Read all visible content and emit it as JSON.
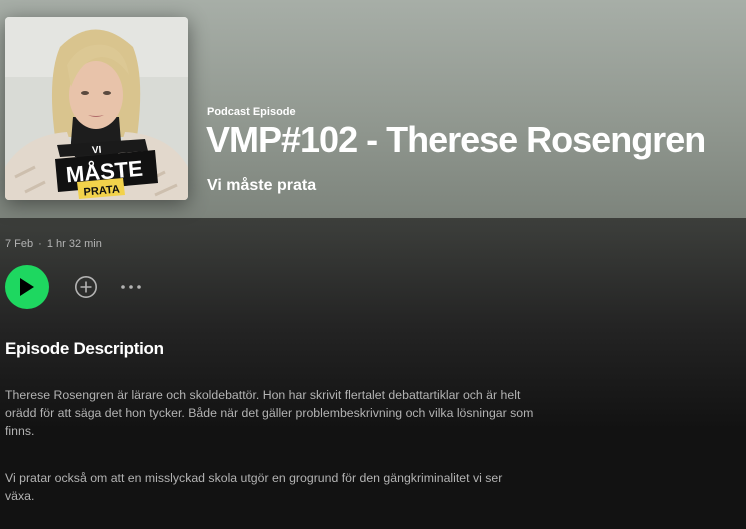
{
  "header": {
    "type_label": "Podcast Episode",
    "title": "VMP#102 - Therese Rosengren",
    "show_name": "Vi måste prata"
  },
  "cover": {
    "logo_line1": "VI",
    "logo_line2": "MÅSTE",
    "logo_line3": "PRATA"
  },
  "meta": {
    "date": "7 Feb",
    "separator": "·",
    "duration": "1 hr 32 min"
  },
  "actions": {
    "play_icon": "play-icon",
    "add_icon": "add-circle-icon",
    "more_icon": "more-options-icon"
  },
  "description": {
    "heading": "Episode Description",
    "paragraph1": "Therese Rosengren är lärare och skoldebattör. Hon har skrivit flertalet debattartiklar och är helt orädd för att säga det hon tycker. Både när det gäller problembeskrivning och vilka lösningar som finns.",
    "paragraph2": "Vi pratar också om att en misslyckad skola utgör en grogrund för den gängkriminalitet vi ser växa."
  },
  "colors": {
    "accent": "#1ed760",
    "background": "#121212",
    "secondary_text": "#b3b3b3"
  }
}
